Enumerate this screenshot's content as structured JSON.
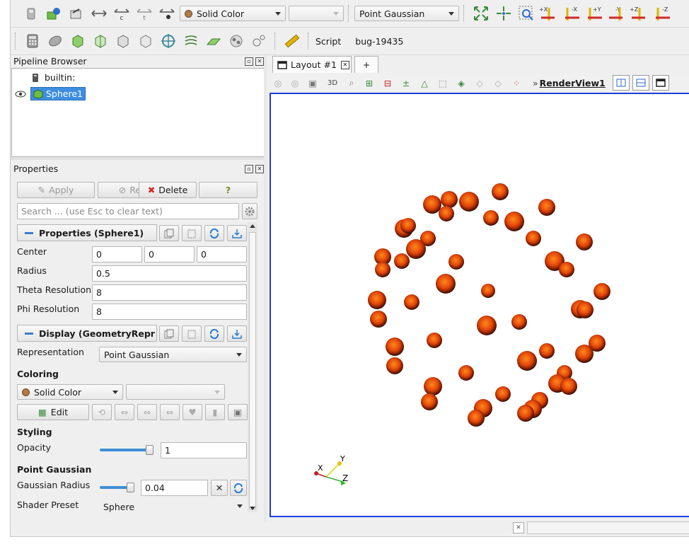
{
  "toolbar": {
    "coloring_value": "Solid Color",
    "component_value": "",
    "representation_value": "Point Gaussian",
    "icons_row1_left": [
      "delete-icon",
      "color-legend-icon",
      "edit-color-map-icon",
      "rescale-data-range-icon",
      "rescale-custom-range-icon",
      "rescale-temporal-range-icon",
      "rescale-visible-range-icon"
    ],
    "icons_row1_right": [
      "reset-camera-icon",
      "zoom-to-data-icon",
      "zoom-to-box-icon",
      "set-view-plus-x-icon",
      "set-view-minus-x-icon",
      "set-view-plus-y-icon",
      "set-view-minus-y-icon",
      "set-view-plus-z-icon",
      "set-view-minus-z-icon"
    ],
    "icons_row2": [
      "calculator-icon",
      "contour-icon",
      "clip-icon",
      "slice-icon",
      "threshold-icon",
      "extract-subset-icon",
      "glyph-icon",
      "stream-tracer-icon",
      "warp-icon",
      "group-datasets-icon",
      "extract-level-icon"
    ],
    "script_label": "Script",
    "macro_label": "bug-19435"
  },
  "pipeline_browser": {
    "title": "Pipeline Browser",
    "root_label": "builtin:",
    "items": [
      {
        "label": "Sphere1",
        "selected": true,
        "visible": true
      }
    ]
  },
  "properties": {
    "title": "Properties",
    "apply_label": "Apply",
    "reset_label": "Reset",
    "delete_label": "Delete",
    "help_label": "?",
    "search_placeholder": "Search ... (use Esc to clear text)",
    "section_properties": "Properties (Sphere1)",
    "center_label": "Center",
    "center_x": "0",
    "center_y": "0",
    "center_z": "0",
    "radius_label": "Radius",
    "radius_value": "0.5",
    "theta_label": "Theta Resolution",
    "theta_value": "8",
    "phi_label": "Phi Resolution",
    "phi_value": "8",
    "section_display": "Display (GeometryRepr",
    "representation_label": "Representation",
    "representation_value": "Point Gaussian",
    "coloring_title": "Coloring",
    "coloring_value": "Solid Color",
    "edit_label": "Edit",
    "styling_title": "Styling",
    "opacity_label": "Opacity",
    "opacity_value": "1",
    "opacity_fraction": 1.0,
    "point_gaussian_title": "Point Gaussian",
    "gaussian_radius_label": "Gaussian Radius",
    "gaussian_radius_value": "0.04",
    "shader_preset_label": "Shader Preset",
    "shader_preset_value": "Sphere"
  },
  "layout": {
    "tab_label": "Layout #1",
    "add_tab_label": "+",
    "view_3d_label": "3D",
    "render_view_label": "RenderView1"
  },
  "axes": {
    "x": "X",
    "y": "Y",
    "z": "Z"
  },
  "colors": {
    "sphere": "#e85a0c",
    "sphere_dark": "#3a0e00",
    "selection": "#3d8ee0",
    "viewport_border": "#1d3fdc"
  }
}
